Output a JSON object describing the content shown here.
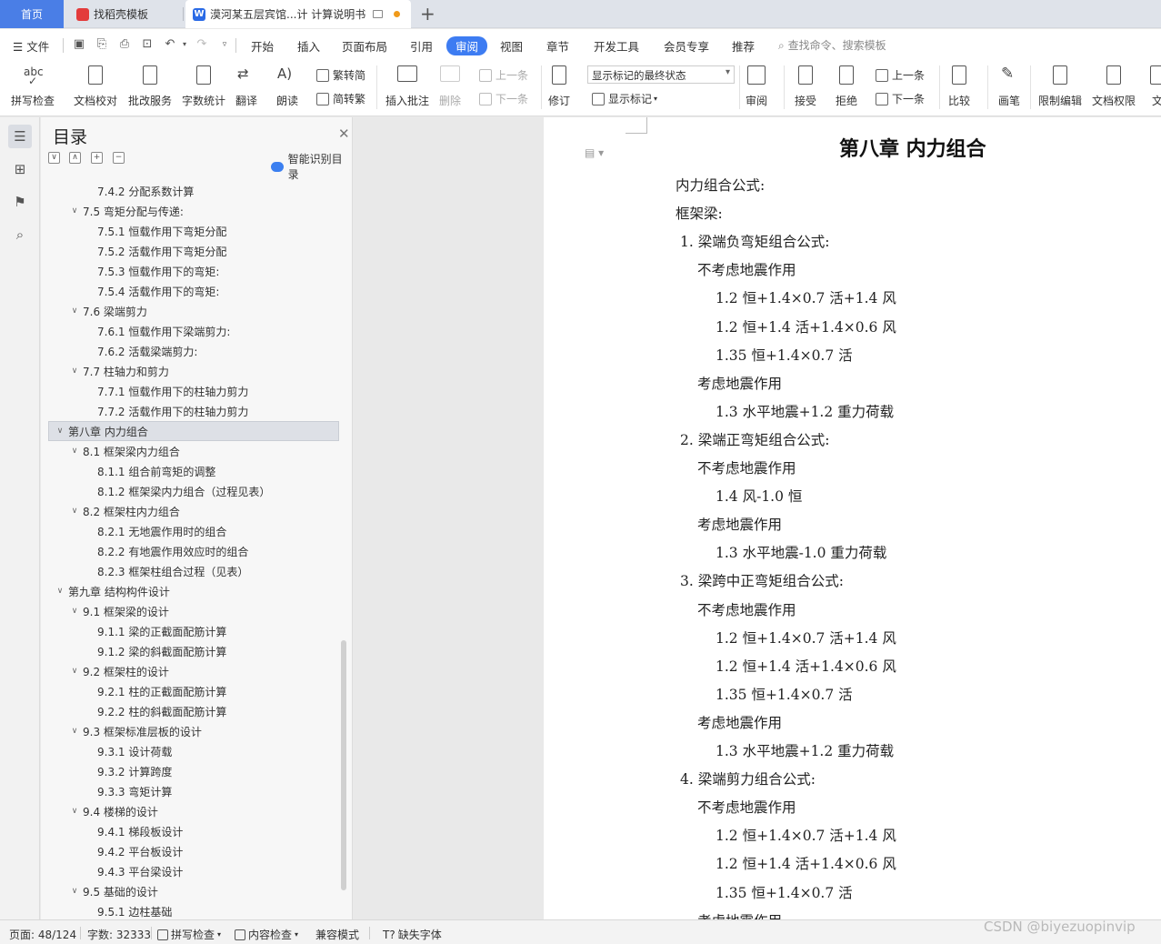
{
  "tabs": {
    "home": "首页",
    "template": "找稻壳模板",
    "document": "漠河某五层宾馆...计 计算说明书"
  },
  "menu": {
    "file": "文件",
    "items": [
      "开始",
      "插入",
      "页面布局",
      "引用",
      "审阅",
      "视图",
      "章节",
      "开发工具",
      "会员专享",
      "推荐"
    ],
    "active": "审阅",
    "search_placeholder": "查找命令、搜索模板"
  },
  "ribbon": {
    "spell_icon_text": "abc",
    "spell": "拼写检查",
    "proofread": "文档校对",
    "revise_service": "批改服务",
    "word_count": "字数统计",
    "translate": "翻译",
    "read_aloud": "朗读",
    "trad_to_simp": "繁转简",
    "simp_to_trad": "简转繁",
    "insert_comment": "插入批注",
    "delete": "删除",
    "prev_comment": "上一条",
    "next_comment": "下一条",
    "track": "修订",
    "markup_state": "显示标记的最终状态",
    "show_markup": "显示标记",
    "review": "审阅",
    "accept": "接受",
    "reject": "拒绝",
    "prev_change": "上一条",
    "next_change": "下一条",
    "compare": "比较",
    "pen": "画笔",
    "restrict": "限制编辑",
    "permission": "文档权限",
    "doc_partial": "文"
  },
  "toc": {
    "title": "目录",
    "smart": "智能识别目录",
    "items": [
      {
        "level": 3,
        "text": "7.4.2 分配系数计算"
      },
      {
        "level": 2,
        "text": "7.5 弯矩分配与传递:",
        "caret": "∨"
      },
      {
        "level": 3,
        "text": "7.5.1 恒载作用下弯矩分配"
      },
      {
        "level": 3,
        "text": "7.5.2 活载作用下弯矩分配"
      },
      {
        "level": 3,
        "text": "7.5.3 恒载作用下的弯矩:"
      },
      {
        "level": 3,
        "text": "7.5.4 活载作用下的弯矩:"
      },
      {
        "level": 2,
        "text": "7.6 梁端剪力",
        "caret": "∨"
      },
      {
        "level": 3,
        "text": "7.6.1 恒载作用下梁端剪力:"
      },
      {
        "level": 3,
        "text": "7.6.2 活载梁端剪力:"
      },
      {
        "level": 2,
        "text": "7.7 柱轴力和剪力",
        "caret": "∨"
      },
      {
        "level": 3,
        "text": "7.7.1 恒载作用下的柱轴力剪力"
      },
      {
        "level": 3,
        "text": "7.7.2 活载作用下的柱轴力剪力"
      },
      {
        "level": 1,
        "text": "第八章  内力组合",
        "caret": "∨",
        "selected": true
      },
      {
        "level": 2,
        "text": "8.1 框架梁内力组合",
        "caret": "∨"
      },
      {
        "level": 3,
        "text": "8.1.1 组合前弯矩的调整"
      },
      {
        "level": 3,
        "text": "8.1.2 框架梁内力组合（过程见表）"
      },
      {
        "level": 2,
        "text": "8.2 框架柱内力组合",
        "caret": "∨"
      },
      {
        "level": 3,
        "text": "8.2.1 无地震作用时的组合"
      },
      {
        "level": 3,
        "text": "8.2.2 有地震作用效应时的组合"
      },
      {
        "level": 3,
        "text": "8.2.3 框架柱组合过程（见表）"
      },
      {
        "level": 1,
        "text": "第九章  结构构件设计",
        "caret": "∨"
      },
      {
        "level": 2,
        "text": "9.1 框架梁的设计",
        "caret": "∨"
      },
      {
        "level": 3,
        "text": "9.1.1 梁的正截面配筋计算"
      },
      {
        "level": 3,
        "text": "9.1.2 梁的斜截面配筋计算"
      },
      {
        "level": 2,
        "text": "9.2 框架柱的设计",
        "caret": "∨"
      },
      {
        "level": 3,
        "text": "9.2.1 柱的正截面配筋计算"
      },
      {
        "level": 3,
        "text": "9.2.2 柱的斜截面配筋计算"
      },
      {
        "level": 2,
        "text": "9.3 框架标准层板的设计",
        "caret": "∨"
      },
      {
        "level": 3,
        "text": "9.3.1 设计荷载"
      },
      {
        "level": 3,
        "text": "9.3.2 计算跨度"
      },
      {
        "level": 3,
        "text": "9.3.3 弯矩计算"
      },
      {
        "level": 2,
        "text": "9.4 楼梯的设计",
        "caret": "∨"
      },
      {
        "level": 3,
        "text": "9.4.1 梯段板设计"
      },
      {
        "level": 3,
        "text": "9.4.2 平台板设计"
      },
      {
        "level": 3,
        "text": "9.4.3 平台梁设计"
      },
      {
        "level": 2,
        "text": " 9.5 基础的设计",
        "caret": "∨"
      },
      {
        "level": 3,
        "text": "9.5.1 边柱基础"
      }
    ]
  },
  "document": {
    "title": "第八章  内力组合",
    "lines": [
      {
        "indent": 0,
        "text": "内力组合公式:"
      },
      {
        "indent": 0,
        "text": "框架梁:"
      },
      {
        "indent": 1,
        "text": "1.  梁端负弯矩组合公式:"
      },
      {
        "indent": 2,
        "text": "不考虑地震作用"
      },
      {
        "indent": 3,
        "text": "1.2 恒+1.4×0.7 活+1.4 风"
      },
      {
        "indent": 3,
        "text": "1.2 恒+1.4 活+1.4×0.6 风"
      },
      {
        "indent": 3,
        "text": "1.35 恒+1.4×0.7 活"
      },
      {
        "indent": 2,
        "text": "考虑地震作用"
      },
      {
        "indent": 3,
        "text": "1.3 水平地震+1.2 重力荷载"
      },
      {
        "indent": 1,
        "text": "2.  梁端正弯矩组合公式:"
      },
      {
        "indent": 2,
        "text": "不考虑地震作用"
      },
      {
        "indent": 3,
        "text": "1.4 风-1.0 恒"
      },
      {
        "indent": 2,
        "text": "考虑地震作用"
      },
      {
        "indent": 3,
        "text": "1.3 水平地震-1.0 重力荷载"
      },
      {
        "indent": 1,
        "text": "3.  梁跨中正弯矩组合公式:"
      },
      {
        "indent": 2,
        "text": "不考虑地震作用"
      },
      {
        "indent": 3,
        "text": "1.2 恒+1.4×0.7 活+1.4 风"
      },
      {
        "indent": 3,
        "text": "1.2 恒+1.4 活+1.4×0.6 风"
      },
      {
        "indent": 3,
        "text": "1.35 恒+1.4×0.7 活"
      },
      {
        "indent": 2,
        "text": "考虑地震作用"
      },
      {
        "indent": 3,
        "text": "1.3 水平地震+1.2 重力荷载"
      },
      {
        "indent": 1,
        "text": "4.  梁端剪力组合公式:"
      },
      {
        "indent": 2,
        "text": "不考虑地震作用"
      },
      {
        "indent": 3,
        "text": "1.2 恒+1.4×0.7 活+1.4 风"
      },
      {
        "indent": 3,
        "text": "1.2 恒+1.4 活+1.4×0.6 风"
      },
      {
        "indent": 3,
        "text": "1.35 恒+1.4×0.7 活"
      },
      {
        "indent": 2,
        "text": "考虑地震作用"
      }
    ]
  },
  "status": {
    "page": "页面: 48/124",
    "words": "字数: 32333",
    "spell": "拼写检查",
    "content": "内容检查",
    "compat": "兼容模式",
    "missing_font": "缺失字体"
  },
  "watermark": "CSDN @biyezuopinvip",
  "colors": {
    "accent": "#3d7cf2",
    "home_tab": "#4a7ee6"
  }
}
